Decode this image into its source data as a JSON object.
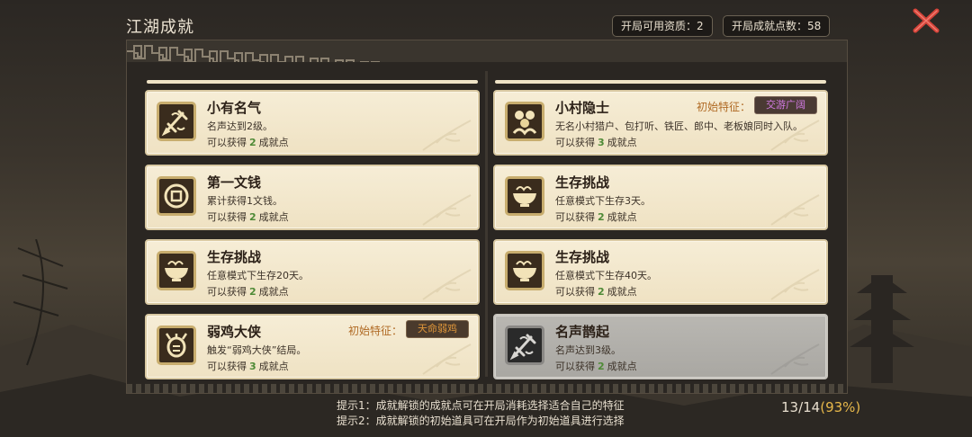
{
  "title": "江湖成就",
  "stats": {
    "resources": "开局可用资质：2",
    "points": "开局成就点数：58"
  },
  "cards": [
    {
      "name": "小有名气",
      "desc": "名声达到2级。",
      "reward_prefix": "可以获得",
      "reward_value": "2",
      "reward_suffix": "成就点",
      "icon": "sword-icon",
      "locked": false
    },
    {
      "name": "小村隐士",
      "desc": "无名小村猎户、包打听、铁匠、郎中、老板娘同时入队。",
      "reward_prefix": "可以获得",
      "reward_value": "3",
      "reward_suffix": "成就点",
      "icon": "villagers-icon",
      "locked": false,
      "trait_label": "初始特征：",
      "trait_badge": "交游广阔",
      "trait_color": "#9b3fb0"
    },
    {
      "name": "第一文钱",
      "desc": "累计获得1文钱。",
      "reward_prefix": "可以获得",
      "reward_value": "2",
      "reward_suffix": "成就点",
      "icon": "coin-icon",
      "locked": false
    },
    {
      "name": "生存挑战",
      "desc": "任意模式下生存3天。",
      "reward_prefix": "可以获得",
      "reward_value": "2",
      "reward_suffix": "成就点",
      "icon": "bowl-icon",
      "locked": false
    },
    {
      "name": "生存挑战",
      "desc": "任意模式下生存20天。",
      "reward_prefix": "可以获得",
      "reward_value": "2",
      "reward_suffix": "成就点",
      "icon": "bowl-icon",
      "locked": false
    },
    {
      "name": "生存挑战",
      "desc": "任意模式下生存40天。",
      "reward_prefix": "可以获得",
      "reward_value": "2",
      "reward_suffix": "成就点",
      "icon": "bowl-icon",
      "locked": false
    },
    {
      "name": "弱鸡大侠",
      "desc": "触发“弱鸡大侠”结局。",
      "reward_prefix": "可以获得",
      "reward_value": "3",
      "reward_suffix": "成就点",
      "icon": "chicken-icon",
      "locked": false,
      "trait_label": "初始特征：",
      "trait_badge": "天命弱鸡",
      "trait_color": "#c77a1e"
    },
    {
      "name": "名声鹊起",
      "desc": "名声达到3级。",
      "reward_prefix": "可以获得",
      "reward_value": "2",
      "reward_suffix": "成就点",
      "icon": "sword-icon",
      "locked": true
    }
  ],
  "hints": [
    "提示1：成就解锁的成就点可在开局消耗选择适合自己的特征",
    "提示2：成就解锁的初始道具可在开局作为初始道具进行选择"
  ],
  "progress": {
    "count": "13/14",
    "percent": "(93%)"
  },
  "colors": {
    "accent": "#e7b84a",
    "reward": "#4e8a36",
    "close": "#d6443a"
  }
}
